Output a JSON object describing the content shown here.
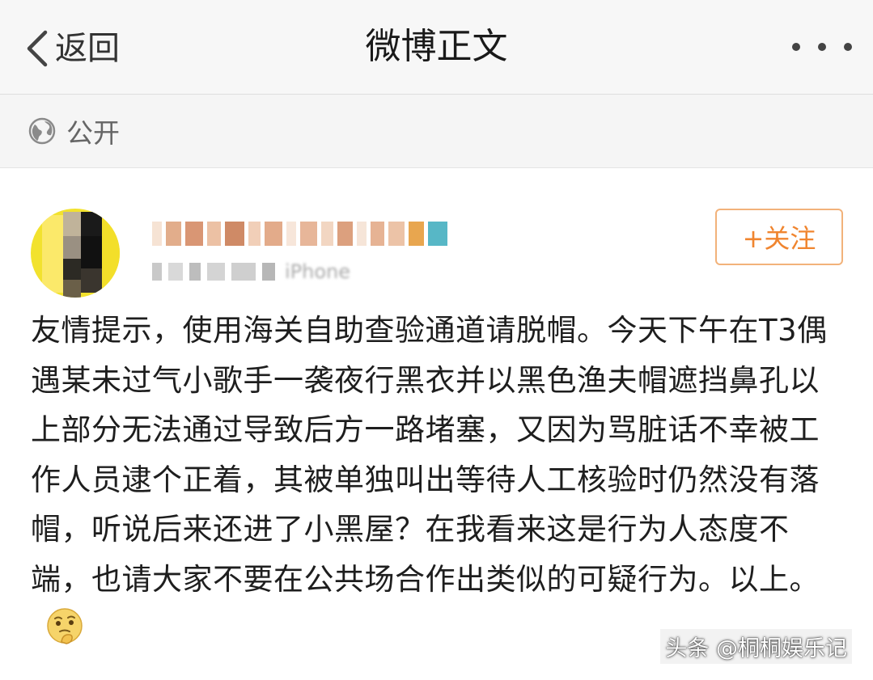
{
  "nav": {
    "back_label": "返回",
    "title": "微博正文",
    "more_icon": "more-dots-icon"
  },
  "visibility": {
    "icon": "globe-icon",
    "label": "公开"
  },
  "post": {
    "avatar": "pixelated-avatar",
    "username": "(mosaic-blurred username)",
    "meta": "iPhone",
    "follow_label": "+关注",
    "body": "友情提示，使用海关自助查验通道请脱帽。今天下午在T3偶遇某未过气小歌手一袭夜行黑衣并以黑色渔夫帽遮挡鼻孔以上部分无法通过导致后方一路堵塞，又因为骂脏话不幸被工作人员逮个正着，其被单独叫出等待人工核验时仍然没有落帽，听说后来还进了小黑屋？在我看来这是行为人态度不端，也请大家不要在公共场合作出类似的可疑行为。以上。",
    "emoji": "thinking-emoji"
  },
  "watermark": "头条 @桐桐娱乐记",
  "colors": {
    "accent_orange": "#f0852f",
    "follow_border": "#f2b27a",
    "nav_bg": "#f7f7f7",
    "text": "#1e1e1e"
  }
}
